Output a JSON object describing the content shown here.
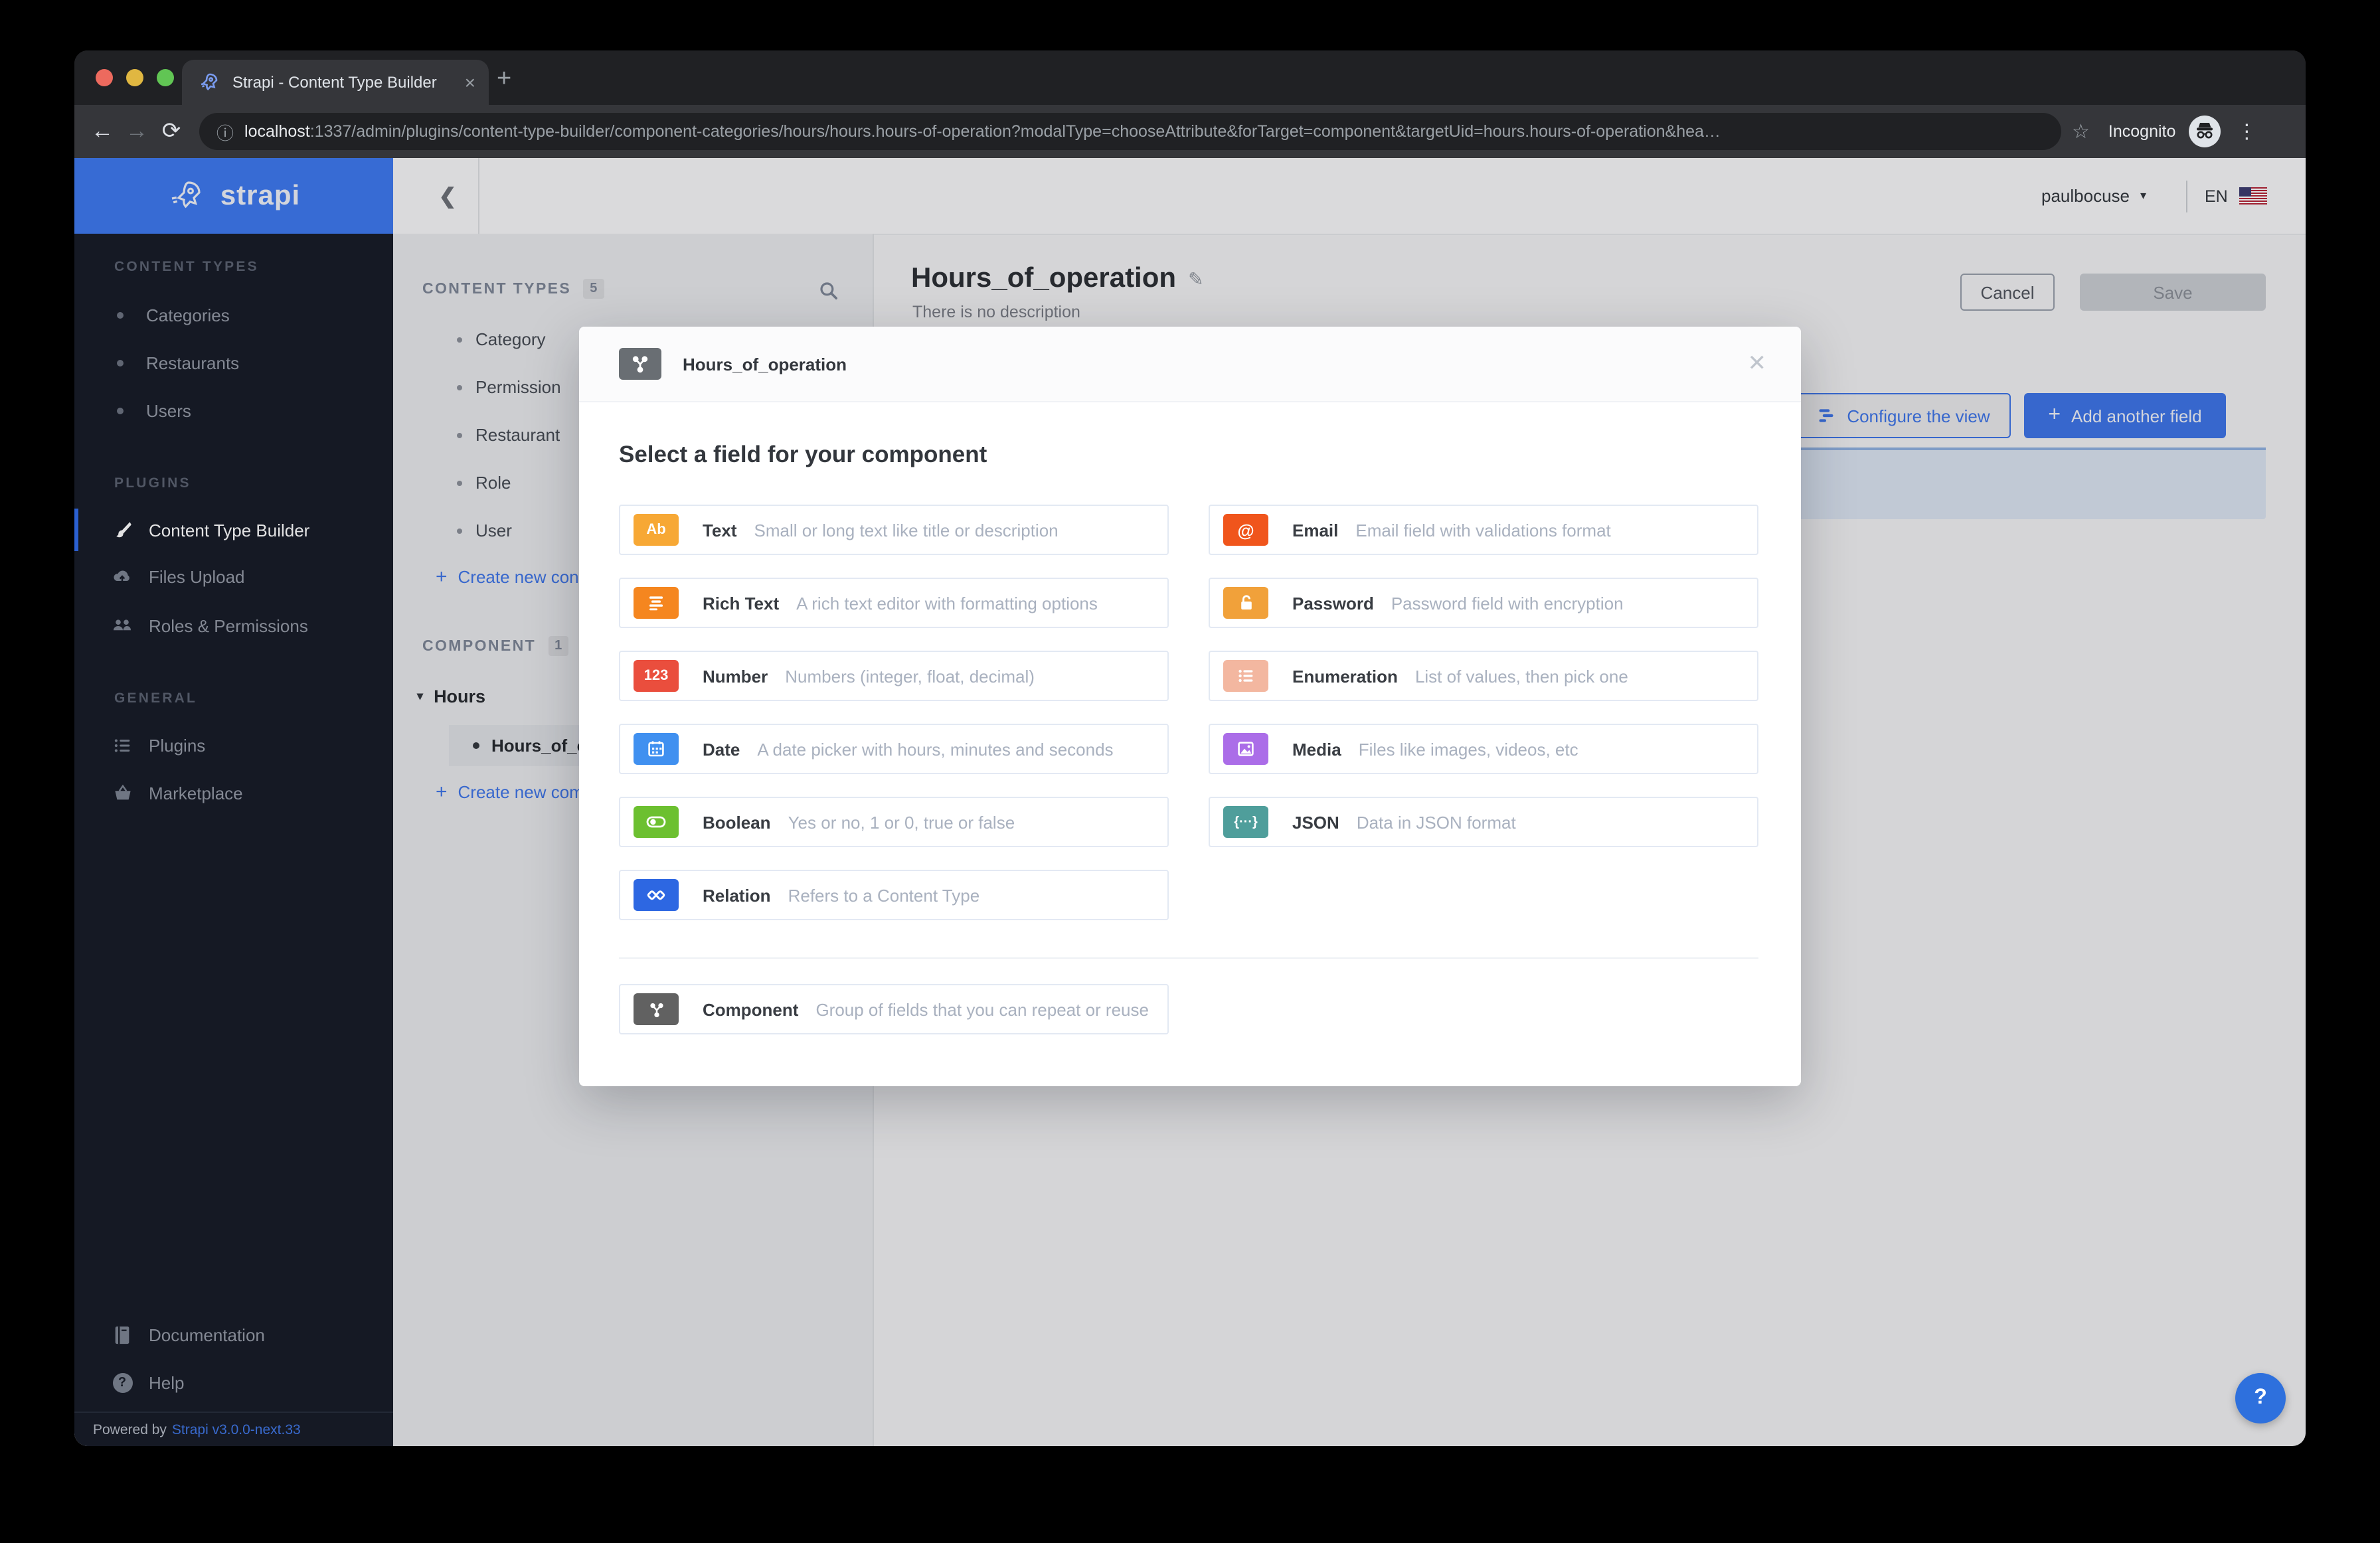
{
  "browser": {
    "tab_title": "Strapi - Content Type Builder",
    "url_host": "localhost",
    "url_rest": ":1337/admin/plugins/content-type-builder/component-categories/hours/hours.hours-of-operation?modalType=chooseAttribute&forTarget=component&targetUid=hours.hours-of-operation&hea…",
    "incognito_label": "Incognito"
  },
  "icons": {
    "back": "←",
    "forward": "→",
    "reload": "⟳",
    "info": "ⓘ",
    "star": "☆",
    "menu_dots": "⋮",
    "tab_close": "×",
    "new_tab": "+",
    "chevron_back": "❮",
    "caret_down": "▾",
    "plus": "+",
    "close": "✕",
    "pencil": "✎",
    "help": "?",
    "text_chip": "Ab",
    "number_chip": "123",
    "email_chip": "@",
    "json_chip": "{···}"
  },
  "sidebar": {
    "logo_text": "strapi",
    "sections": [
      {
        "label": "CONTENT TYPES",
        "items": [
          {
            "label": "Categories"
          },
          {
            "label": "Restaurants"
          },
          {
            "label": "Users"
          }
        ]
      },
      {
        "label": "PLUGINS",
        "items": [
          {
            "label": "Content Type Builder"
          },
          {
            "label": "Files Upload"
          },
          {
            "label": "Roles & Permissions"
          }
        ]
      },
      {
        "label": "GENERAL",
        "items": [
          {
            "label": "Plugins"
          },
          {
            "label": "Marketplace"
          }
        ]
      }
    ],
    "footer": {
      "documentation": "Documentation",
      "help": "Help",
      "powered_prefix": "Powered by",
      "powered_link": "Strapi v3.0.0-next.33"
    }
  },
  "topbar": {
    "user": "paulbocuse",
    "lang": "EN"
  },
  "subnav": {
    "content_types_header": "CONTENT TYPES",
    "content_types_count": "5",
    "content_type_items": [
      {
        "label": "Category"
      },
      {
        "label": "Permission"
      },
      {
        "label": "Restaurant"
      },
      {
        "label": "Role"
      },
      {
        "label": "User"
      }
    ],
    "create_content_type": "Create new con",
    "component_header": "COMPONENT",
    "component_count": "1",
    "component_group": "Hours",
    "component_item": "Hours_of_ope",
    "create_component": "Create new com"
  },
  "page": {
    "title": "Hours_of_operation",
    "subtitle": "There is no description",
    "cancel_label": "Cancel",
    "save_label": "Save",
    "configure_label": "Configure the view",
    "add_field_label": "Add another field"
  },
  "modal": {
    "title": "Hours_of_operation",
    "heading": "Select a field for your component",
    "fields_left": [
      {
        "name": "Text",
        "desc": "Small or long text like title or description",
        "color": "#f7a835"
      },
      {
        "name": "Rich Text",
        "desc": "A rich text editor with formatting options",
        "color": "#f5861f"
      },
      {
        "name": "Number",
        "desc": "Numbers (integer, float, decimal)",
        "color": "#ea4e3d"
      },
      {
        "name": "Date",
        "desc": "A date picker with hours, minutes and seconds",
        "color": "#4090f0"
      },
      {
        "name": "Boolean",
        "desc": "Yes or no, 1 or 0, true or false",
        "color": "#6cc030"
      },
      {
        "name": "Relation",
        "desc": "Refers to a Content Type",
        "color": "#2d67e2"
      }
    ],
    "fields_right": [
      {
        "name": "Email",
        "desc": "Email field with validations format",
        "color": "#f0551c"
      },
      {
        "name": "Password",
        "desc": "Password field with encryption",
        "color": "#f1a13a"
      },
      {
        "name": "Enumeration",
        "desc": "List of values, then pick one",
        "color": "#f3b7a0"
      },
      {
        "name": "Media",
        "desc": "Files like images, videos, etc",
        "color": "#ab6de8"
      },
      {
        "name": "JSON",
        "desc": "Data in JSON format",
        "color": "#4f9e9b"
      }
    ],
    "component_field": {
      "name": "Component",
      "desc": "Group of fields that you can repeat or reuse",
      "color": "#616161"
    }
  },
  "colors": {
    "brand_blue": "#3d74e6",
    "sidebar_dark": "#161b26",
    "accent_header_blue": "#3d78ee",
    "panel_blue": "#dae3ef"
  }
}
